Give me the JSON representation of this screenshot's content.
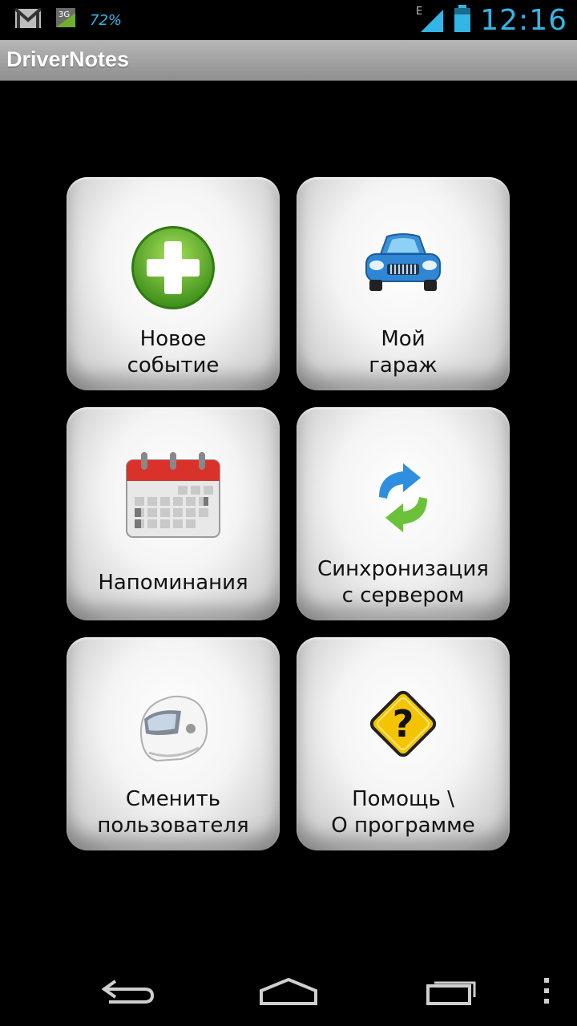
{
  "status_bar": {
    "notif_icons": [
      "gmail-icon",
      "3g-icon"
    ],
    "net_label": "3G",
    "battery_pct": "72%",
    "signal_type": "E",
    "time": "12:16"
  },
  "app": {
    "title": "DriverNotes"
  },
  "tiles": [
    {
      "icon": "add-icon",
      "line1": "Новое",
      "line2": "событие"
    },
    {
      "icon": "car-icon",
      "line1": "Мой",
      "line2": "гараж"
    },
    {
      "icon": "calendar-icon",
      "line1": "Напоминания",
      "line2": ""
    },
    {
      "icon": "sync-icon",
      "line1": "Синхронизация",
      "line2": "с сервером"
    },
    {
      "icon": "helmet-icon",
      "line1": "Сменить",
      "line2": "пользователя"
    },
    {
      "icon": "help-icon",
      "line1": "Помощь \\",
      "line2": "О программе"
    }
  ],
  "nav": {
    "buttons": [
      "back-icon",
      "home-icon",
      "recent-apps-icon",
      "overflow-menu-icon"
    ]
  },
  "colors": {
    "accent": "#33b5e5",
    "actionbar": "#a4a4a4",
    "background": "#000000"
  }
}
